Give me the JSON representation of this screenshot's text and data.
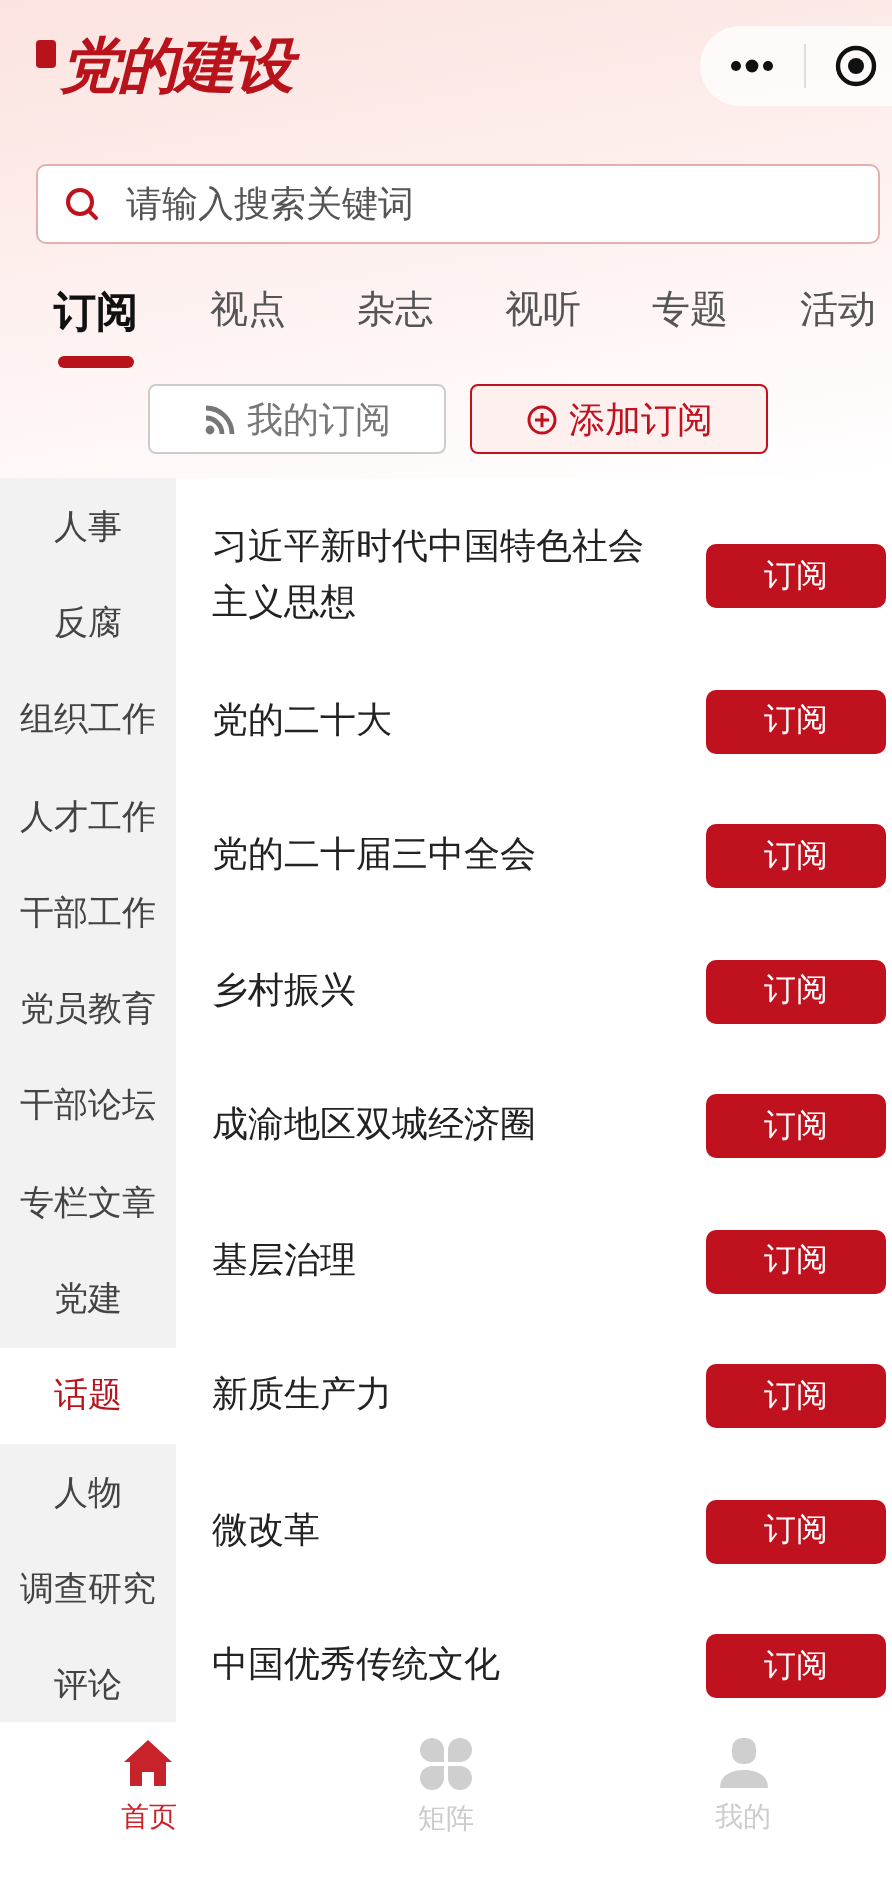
{
  "header": {
    "logo": "党的建设"
  },
  "search": {
    "placeholder": "请输入搜索关键词"
  },
  "tabs": [
    {
      "label": "订阅",
      "selected": true
    },
    {
      "label": "视点",
      "selected": false
    },
    {
      "label": "杂志",
      "selected": false
    },
    {
      "label": "视听",
      "selected": false
    },
    {
      "label": "专题",
      "selected": false
    },
    {
      "label": "活动",
      "selected": false
    }
  ],
  "sub_buttons": [
    {
      "label": "我的订阅",
      "selected": false
    },
    {
      "label": "添加订阅",
      "selected": true
    }
  ],
  "sidebar": {
    "items": [
      {
        "label": "人事",
        "selected": false
      },
      {
        "label": "反腐",
        "selected": false
      },
      {
        "label": "组织工作",
        "selected": false
      },
      {
        "label": "人才工作",
        "selected": false
      },
      {
        "label": "干部工作",
        "selected": false
      },
      {
        "label": "党员教育",
        "selected": false
      },
      {
        "label": "干部论坛",
        "selected": false
      },
      {
        "label": "专栏文章",
        "selected": false
      },
      {
        "label": "党建",
        "selected": false
      },
      {
        "label": "话题",
        "selected": true
      },
      {
        "label": "人物",
        "selected": false
      },
      {
        "label": "调查研究",
        "selected": false
      },
      {
        "label": "评论",
        "selected": false
      }
    ]
  },
  "topics": [
    {
      "title": "习近平新时代中国特色社会主义思想",
      "button": "订阅"
    },
    {
      "title": "党的二十大",
      "button": "订阅"
    },
    {
      "title": "党的二十届三中全会",
      "button": "订阅"
    },
    {
      "title": "乡村振兴",
      "button": "订阅"
    },
    {
      "title": "成渝地区双城经济圈",
      "button": "订阅"
    },
    {
      "title": "基层治理",
      "button": "订阅"
    },
    {
      "title": "新质生产力",
      "button": "订阅"
    },
    {
      "title": "微改革",
      "button": "订阅"
    },
    {
      "title": "中国优秀传统文化",
      "button": "订阅"
    }
  ],
  "bottom_nav": [
    {
      "label": "首页",
      "selected": true,
      "kind": "home"
    },
    {
      "label": "矩阵",
      "selected": false,
      "kind": "grid"
    },
    {
      "label": "我的",
      "selected": false,
      "kind": "person"
    }
  ]
}
